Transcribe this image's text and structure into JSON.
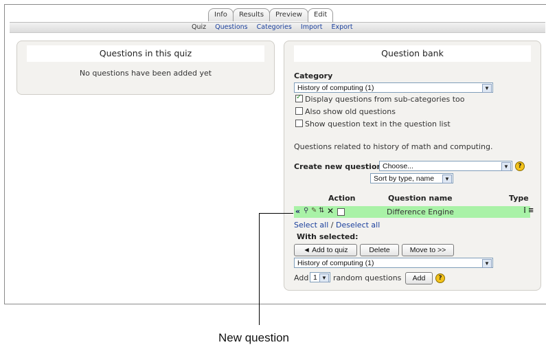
{
  "tabs": [
    "Info",
    "Results",
    "Preview",
    "Edit"
  ],
  "subtabs": {
    "current": "Quiz",
    "links": [
      "Questions",
      "Categories",
      "Import",
      "Export"
    ]
  },
  "left_panel": {
    "title": "Questions in this quiz",
    "message": "No questions have been added yet"
  },
  "bank": {
    "title": "Question bank",
    "category_label": "Category",
    "category_value": "History of computing (1)",
    "checkboxes": [
      {
        "label": "Display questions from sub-categories too",
        "checked": true
      },
      {
        "label": "Also show old questions",
        "checked": false
      },
      {
        "label": "Show question text in the question list",
        "checked": false
      }
    ],
    "category_info": "Questions related to history of math and computing.",
    "create_label": "Create new question",
    "create_value": "Choose...",
    "sort_value": "Sort by type, name",
    "columns": {
      "action": "Action",
      "name": "Question name",
      "type": "Type"
    },
    "question": {
      "name": "Difference Engine"
    },
    "select_all": "Select all",
    "separator": "/",
    "deselect_all": "Deselect all",
    "with_selected": "With selected:",
    "buttons": {
      "add_to_quiz": "◄ Add to quiz",
      "delete": "Delete",
      "move_to": "Move to >>"
    },
    "move_category": "History of computing (1)",
    "random": {
      "prefix": "Add",
      "count": "1",
      "suffix": "random questions",
      "button": "Add"
    }
  },
  "callout": "New question",
  "colors": {
    "highlight_row": "#a9f2a7",
    "link": "#1a3f9c",
    "panel": "#f3f2ef"
  }
}
